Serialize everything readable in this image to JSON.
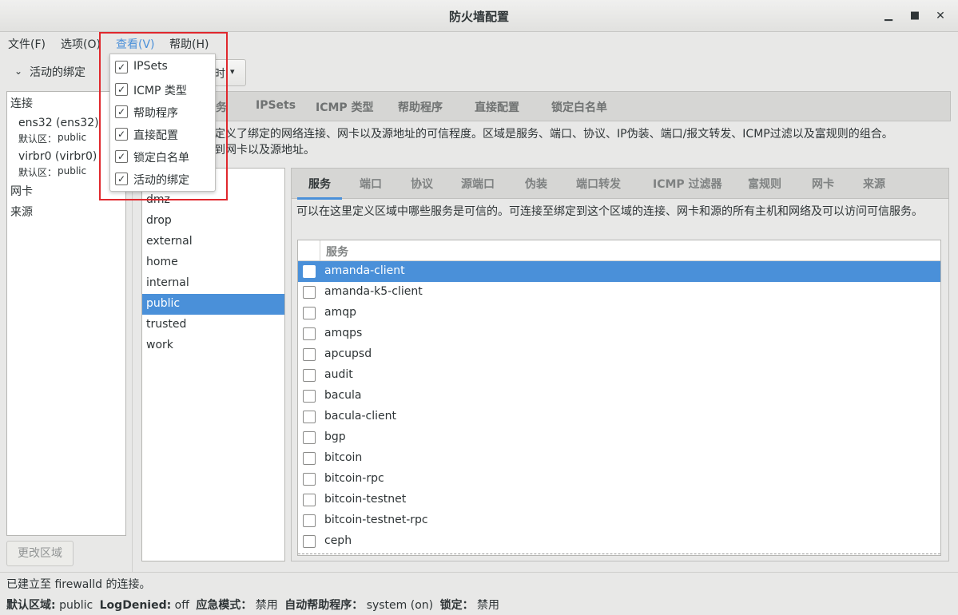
{
  "window": {
    "title": "防火墙配置",
    "minimize_glyph": "▁",
    "maximize_glyph": "■",
    "close_glyph": "✕"
  },
  "menubar": {
    "items": [
      "文件(F)",
      "选项(O)",
      "查看(V)",
      "帮助(H)"
    ]
  },
  "view_menu": {
    "items": [
      {
        "label": "IPSets",
        "checked": true
      },
      {
        "label": "ICMP 类型",
        "checked": true
      },
      {
        "label": "帮助程序",
        "checked": true
      },
      {
        "label": "直接配置",
        "checked": true
      },
      {
        "label": "锁定白名单",
        "checked": true
      },
      {
        "label": "活动的绑定",
        "checked": true
      }
    ],
    "check_glyph": "✓"
  },
  "sidebar": {
    "header": "活动的绑定",
    "expand_glyph": "⌄",
    "connections_label": "连接",
    "connections": [
      {
        "name": "ens32 (ens32)",
        "zone_label": "默认区：",
        "zone": "public"
      },
      {
        "name": "virbr0 (virbr0)",
        "zone_label": "默认区：",
        "zone": "public"
      }
    ],
    "interfaces_label": "网卡",
    "sources_label": "来源",
    "change_zone_button": "更改区域"
  },
  "configuration": {
    "combo_partial": "时",
    "combo_arrow": "▾"
  },
  "top_tabs": [
    "务",
    "IPSets",
    "ICMP 类型",
    "帮助程序",
    "直接配置",
    "锁定白名单"
  ],
  "zone_description": {
    "line1": "定义了绑定的网络连接、网卡以及源地址的可信程度。区域是服务、端口、协议、IP伪装、端口/报文转发、ICMP过滤以及富规则的组合。",
    "line2": "到网卡以及源地址。"
  },
  "zones": [
    "dmz",
    "drop",
    "external",
    "home",
    "internal",
    "public",
    "trusted",
    "work"
  ],
  "selected_zone": "public",
  "zone_tabs": [
    "服务",
    "端口",
    "协议",
    "源端口",
    "伪装",
    "端口转发",
    "ICMP 过滤器",
    "富规则",
    "网卡",
    "来源"
  ],
  "services_description": "可以在这里定义区域中哪些服务是可信的。可连接至绑定到这个区域的连接、网卡和源的所有主机和网络及可以访问可信服务。",
  "services_header": "服务",
  "services": [
    "amanda-client",
    "amanda-k5-client",
    "amqp",
    "amqps",
    "apcupsd",
    "audit",
    "bacula",
    "bacula-client",
    "bgp",
    "bitcoin",
    "bitcoin-rpc",
    "bitcoin-testnet",
    "bitcoin-testnet-rpc",
    "ceph"
  ],
  "selected_service": "amanda-client",
  "status": {
    "connection": "已建立至  firewalld 的连接。",
    "default_zone_label": "默认区域:",
    "default_zone": "public",
    "log_denied_label": "LogDenied:",
    "log_denied": "off",
    "panic_label": "应急模式：",
    "panic": "禁用",
    "helper_label": "自动帮助程序：",
    "helper": "system (on)",
    "lockdown_label": "锁定：",
    "lockdown": "禁用"
  },
  "colors": {
    "accent": "#4a90d9",
    "highlight_box": "#e0282d"
  }
}
